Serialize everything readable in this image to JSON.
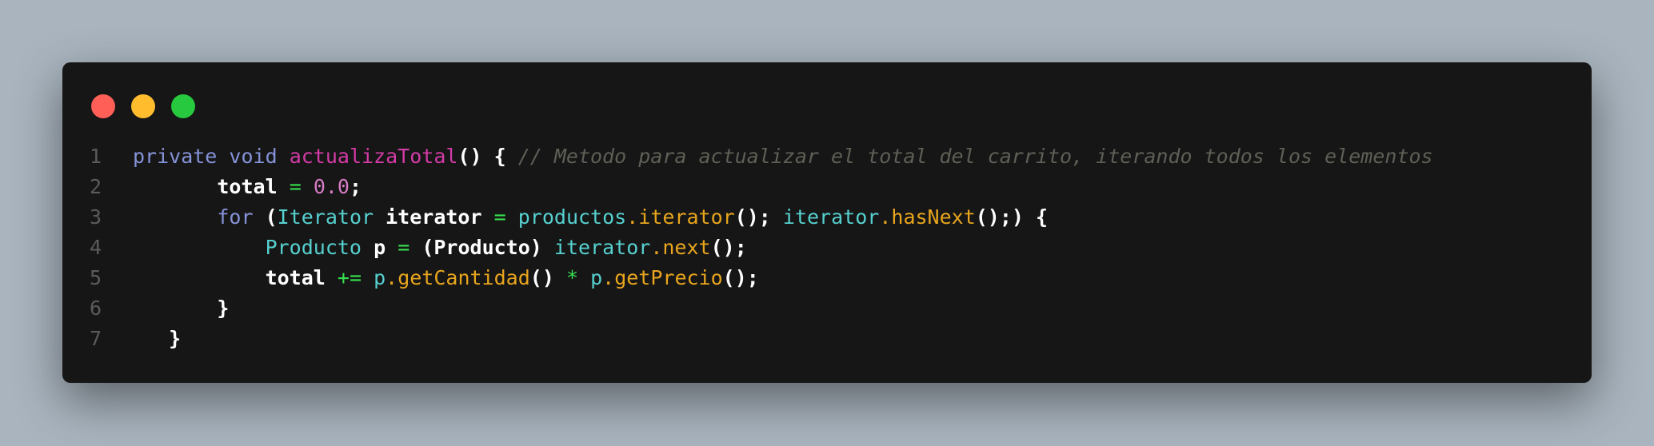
{
  "window": {
    "buttons": {
      "close_color": "#ff5f56",
      "minimize_color": "#ffbd2e",
      "maximize_color": "#27c93f"
    }
  },
  "code": {
    "line_numbers": [
      "1",
      "2",
      "3",
      "4",
      "5",
      "6",
      "7"
    ],
    "lines": [
      {
        "indent": "",
        "tokens": [
          {
            "t": "private",
            "c": "kw"
          },
          {
            "t": " ",
            "c": ""
          },
          {
            "t": "void",
            "c": "kw"
          },
          {
            "t": " ",
            "c": ""
          },
          {
            "t": "actualizaTotal",
            "c": "fn"
          },
          {
            "t": "() {",
            "c": "def"
          },
          {
            "t": " ",
            "c": ""
          },
          {
            "t": "// Metodo para actualizar el total del carrito, iterando todos los elementos",
            "c": "cmt"
          }
        ]
      },
      {
        "indent": "       ",
        "tokens": [
          {
            "t": "total",
            "c": "id"
          },
          {
            "t": " ",
            "c": ""
          },
          {
            "t": "=",
            "c": "op"
          },
          {
            "t": " ",
            "c": ""
          },
          {
            "t": "0.0",
            "c": "num"
          },
          {
            "t": ";",
            "c": "def"
          }
        ]
      },
      {
        "indent": "       ",
        "tokens": [
          {
            "t": "for",
            "c": "kw"
          },
          {
            "t": " ",
            "c": ""
          },
          {
            "t": "(",
            "c": "def"
          },
          {
            "t": "Iterator",
            "c": "type"
          },
          {
            "t": " ",
            "c": ""
          },
          {
            "t": "iterator",
            "c": "id"
          },
          {
            "t": " ",
            "c": ""
          },
          {
            "t": "=",
            "c": "op"
          },
          {
            "t": " ",
            "c": ""
          },
          {
            "t": "productos",
            "c": "type"
          },
          {
            "t": ".",
            "c": "meth"
          },
          {
            "t": "iterator",
            "c": "meth"
          },
          {
            "t": "();",
            "c": "def"
          },
          {
            "t": " ",
            "c": ""
          },
          {
            "t": "iterator",
            "c": "type"
          },
          {
            "t": ".",
            "c": "meth"
          },
          {
            "t": "hasNext",
            "c": "meth"
          },
          {
            "t": "();) {",
            "c": "def"
          }
        ]
      },
      {
        "indent": "           ",
        "tokens": [
          {
            "t": "Producto",
            "c": "type"
          },
          {
            "t": " ",
            "c": ""
          },
          {
            "t": "p",
            "c": "id"
          },
          {
            "t": " ",
            "c": ""
          },
          {
            "t": "=",
            "c": "op"
          },
          {
            "t": " ",
            "c": ""
          },
          {
            "t": "(Producto)",
            "c": "def"
          },
          {
            "t": " ",
            "c": ""
          },
          {
            "t": "iterator",
            "c": "type"
          },
          {
            "t": ".",
            "c": "meth"
          },
          {
            "t": "next",
            "c": "meth"
          },
          {
            "t": "();",
            "c": "def"
          }
        ]
      },
      {
        "indent": "           ",
        "tokens": [
          {
            "t": "total",
            "c": "id"
          },
          {
            "t": " ",
            "c": ""
          },
          {
            "t": "+=",
            "c": "op"
          },
          {
            "t": " ",
            "c": ""
          },
          {
            "t": "p",
            "c": "type"
          },
          {
            "t": ".",
            "c": "meth"
          },
          {
            "t": "getCantidad",
            "c": "meth"
          },
          {
            "t": "()",
            "c": "def"
          },
          {
            "t": " ",
            "c": ""
          },
          {
            "t": "*",
            "c": "op"
          },
          {
            "t": " ",
            "c": ""
          },
          {
            "t": "p",
            "c": "type"
          },
          {
            "t": ".",
            "c": "meth"
          },
          {
            "t": "getPrecio",
            "c": "meth"
          },
          {
            "t": "();",
            "c": "def"
          }
        ]
      },
      {
        "indent": "       ",
        "tokens": [
          {
            "t": "}",
            "c": "def"
          }
        ]
      },
      {
        "indent": "   ",
        "tokens": [
          {
            "t": "}",
            "c": "def"
          }
        ]
      }
    ]
  }
}
